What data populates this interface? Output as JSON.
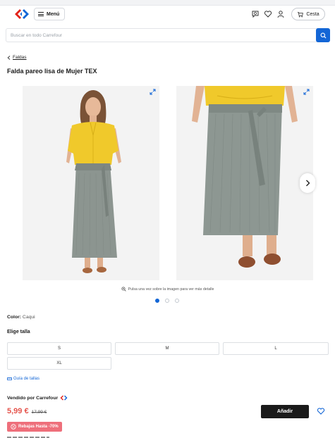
{
  "header": {
    "logo": "carrefour-logo",
    "menu_label": "Menú",
    "icons": [
      "chat-icon",
      "heart-icon",
      "user-icon"
    ],
    "cart_label": "Cesta"
  },
  "search": {
    "placeholder": "Buscar en todo Carrefour"
  },
  "breadcrumb": {
    "label": "Faldas"
  },
  "product": {
    "title": "Falda pareo lisa de Mujer TEX",
    "images": [
      "model-front-view",
      "skirt-detail-view"
    ]
  },
  "gallery": {
    "zoom_hint": "Pulsa una vez sobre la imagen para ver más detalle",
    "dots": 3,
    "active_dot": 0
  },
  "color": {
    "label": "Color:",
    "value": "Caqui"
  },
  "sizes": {
    "heading": "Elige talla",
    "options": [
      "S",
      "M",
      "L",
      "XL"
    ],
    "guide_label": "Guía de tallas"
  },
  "seller": {
    "label": "Vendido por Carrefour"
  },
  "price": {
    "current": "5,99 €",
    "original": "17,99 €"
  },
  "actions": {
    "add_label": "Añadir"
  },
  "badge": {
    "label": "Rebajas Hasta -70%"
  },
  "colors": {
    "accent": "#1366d6",
    "price": "#e5534b",
    "badge": "#ee6f7b",
    "button": "#1a1a1a"
  }
}
